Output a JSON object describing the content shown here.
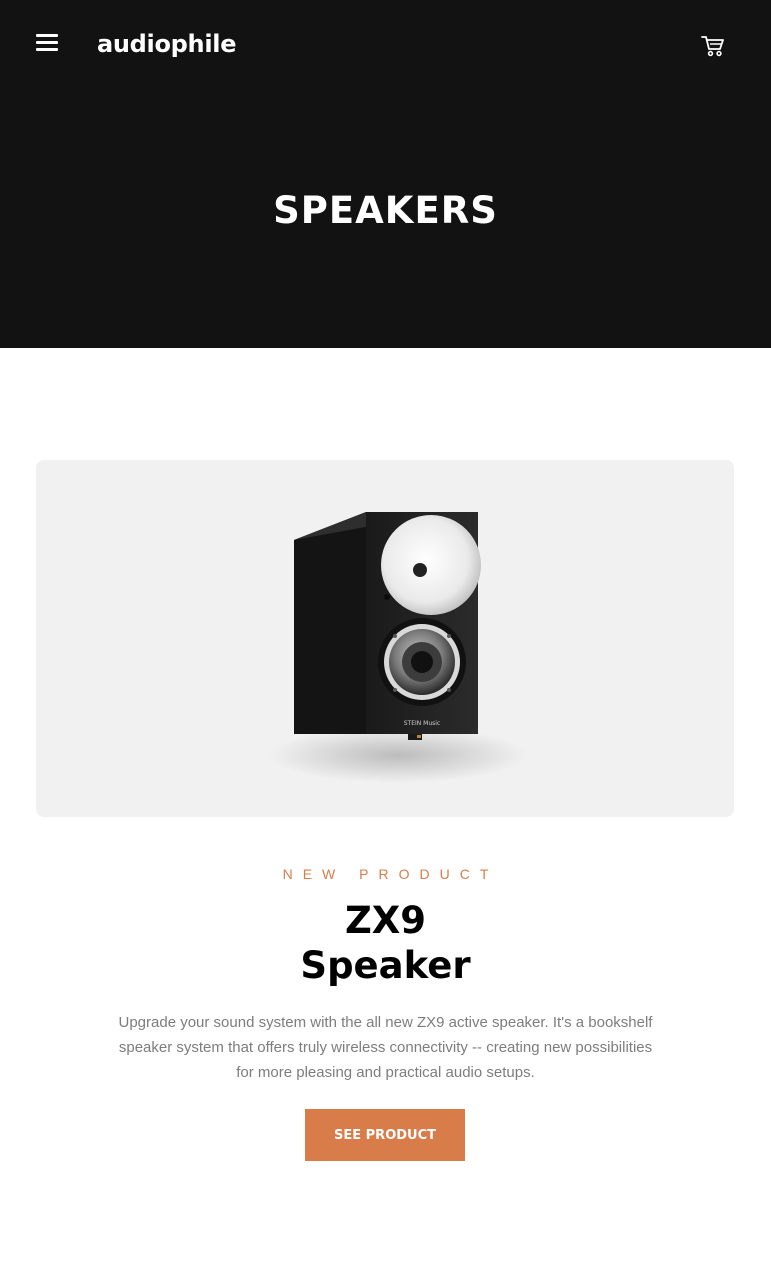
{
  "header": {
    "logo": "audiophile",
    "page_title": "SPEAKERS",
    "menu_icon": "hamburger-menu-icon",
    "cart_icon": "cart-icon"
  },
  "product": {
    "eyebrow": "NEW PRODUCT",
    "name_line1": "ZX9",
    "name_line2": "Speaker",
    "description": "Upgrade your sound system with the all new ZX9 active speaker. It's a bookshelf speaker system that offers truly wireless connectivity -- creating new possibilities for more pleasing and practical audio setups.",
    "cta_label": "SEE PRODUCT",
    "image_brand_text": "STEIN Music"
  },
  "colors": {
    "header_bg": "#121212",
    "accent": "#d87d4a",
    "image_bg": "#f1f1f1",
    "body_text": "#7d7d7d"
  }
}
